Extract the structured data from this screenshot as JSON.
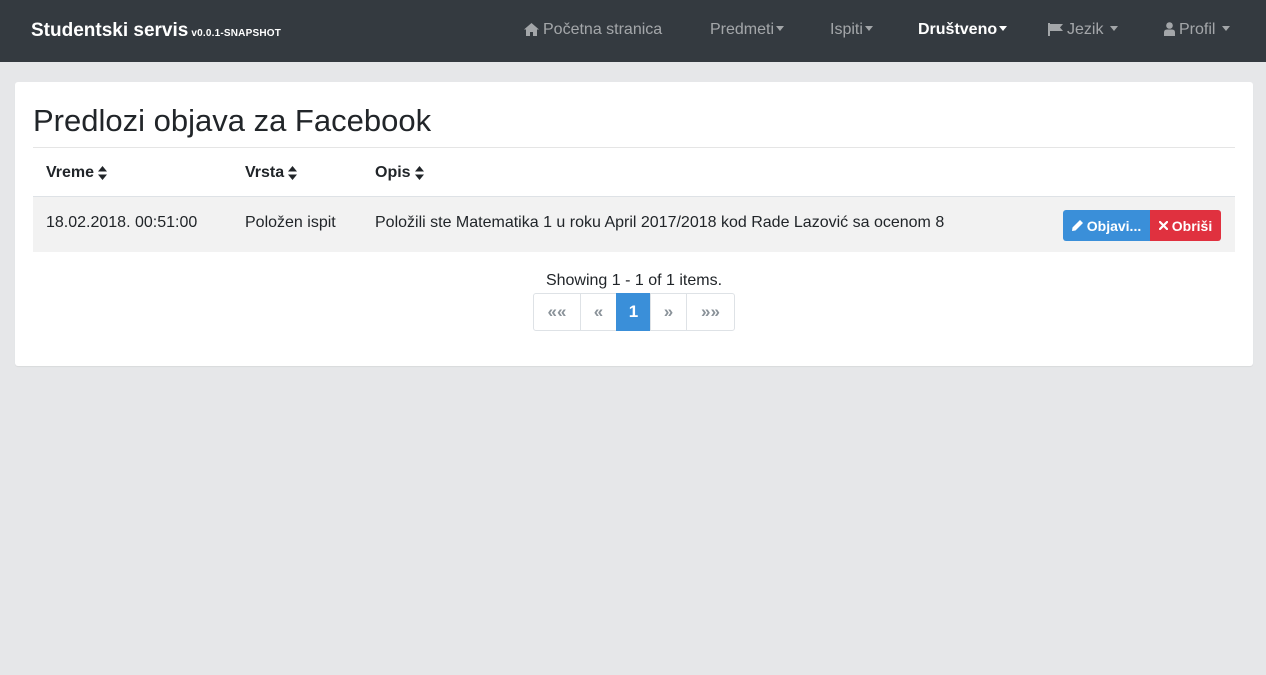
{
  "navbar": {
    "brand": "Studentski servis",
    "version": "v0.0.1-SNAPSHOT",
    "items": [
      {
        "label": "Početna stranica",
        "icon": "home-icon"
      },
      {
        "label": "Predmeti"
      },
      {
        "label": "Ispiti"
      },
      {
        "label": "Društveno",
        "active": true
      },
      {
        "label": "Jezik",
        "icon": "flag-icon"
      },
      {
        "label": "Profil",
        "icon": "user-icon"
      }
    ]
  },
  "page": {
    "title": "Predlozi objava za Facebook"
  },
  "table": {
    "columns": [
      "Vreme",
      "Vrsta",
      "Opis"
    ],
    "rows": [
      {
        "vreme": "18.02.2018. 00:51:00",
        "vrsta": "Položen ispit",
        "opis": "Položili ste Matematika 1 u roku April 2017/2018 kod Rade Lazović sa ocenom 8",
        "actions": {
          "publish": "Objavi...",
          "delete": "Obriši"
        }
      }
    ]
  },
  "pagination": {
    "summary": "Showing 1 - 1 of 1 items.",
    "first": "««",
    "prev": "«",
    "current": "1",
    "next": "»",
    "last": "»»"
  },
  "colors": {
    "navbar": "#343a40",
    "primary": "#3a8fd9",
    "danger": "#e0313f",
    "background": "#e6e7e9"
  }
}
